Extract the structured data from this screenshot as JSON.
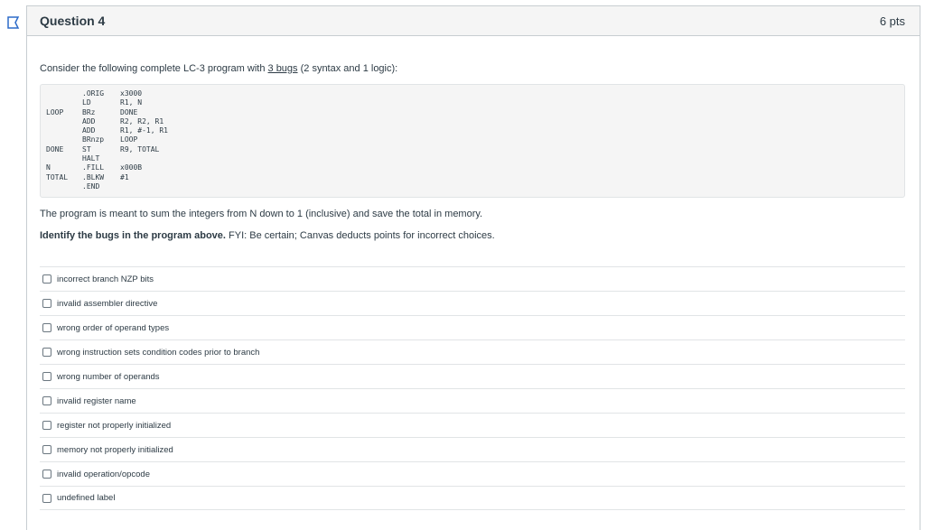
{
  "question": {
    "title": "Question 4",
    "points": "6 pts",
    "intro_prefix": "Consider the following complete LC-3 program with ",
    "intro_link": "3 bugs",
    "intro_suffix": " (2 syntax and 1 logic):",
    "code": [
      {
        "label": "",
        "op": ".ORIG",
        "args": "x3000"
      },
      {
        "label": "",
        "op": "LD",
        "args": "R1, N"
      },
      {
        "label": "LOOP",
        "op": "BRz",
        "args": "DONE"
      },
      {
        "label": "",
        "op": "ADD",
        "args": "R2, R2, R1"
      },
      {
        "label": "",
        "op": "ADD",
        "args": "R1, #-1, R1"
      },
      {
        "label": "",
        "op": "BRnzp",
        "args": "LOOP"
      },
      {
        "label": "DONE",
        "op": "ST",
        "args": "R9, TOTAL"
      },
      {
        "label": "",
        "op": "HALT",
        "args": ""
      },
      {
        "label": "N",
        "op": ".FILL",
        "args": "x000B"
      },
      {
        "label": "TOTAL",
        "op": ".BLKW",
        "args": "#1"
      },
      {
        "label": "",
        "op": ".END",
        "args": ""
      }
    ],
    "description": "The program is meant to sum the integers from N down to 1 (inclusive) and save the total in memory.",
    "identify_bold": "Identify the bugs in the program above.",
    "identify_rest": " FYI: Be certain; Canvas deducts points for incorrect choices.",
    "answers": [
      "incorrect branch NZP bits",
      "invalid assembler directive",
      "wrong order of operand types",
      "wrong instruction sets condition codes prior to branch",
      "wrong number of operands",
      "invalid register name",
      "register not properly initialized",
      "memory not properly initialized",
      "invalid operation/opcode",
      "undefined label"
    ]
  },
  "colors": {
    "flag": "#2d6bc9",
    "header_bg": "#f5f5f5",
    "text": "#2d3b45"
  }
}
